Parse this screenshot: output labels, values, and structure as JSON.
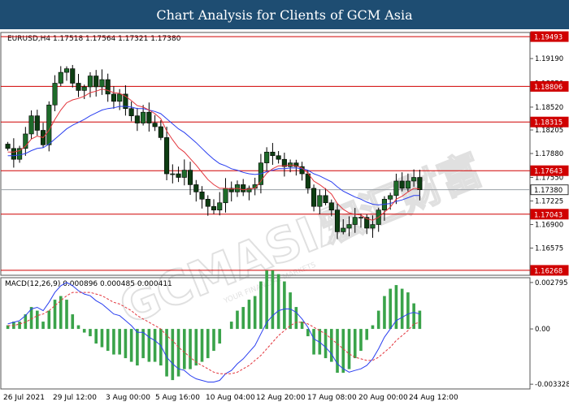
{
  "banner": {
    "title": "Chart Analysis for Clients of GCM Asia"
  },
  "watermark": {
    "brand": "GCMASIA",
    "tagline": "YOUR FINANCIAL MARKETS",
    "chinese": "宏汇财富"
  },
  "chart_data": [
    {
      "type": "candlestick",
      "header": "EURUSD,H4  1.17518 1.17564 1.17321 1.17380",
      "symbol": "EURUSD",
      "timeframe": "H4",
      "ohlc_last": {
        "open": 1.17518,
        "high": 1.17564,
        "low": 1.17321,
        "close": 1.1738
      },
      "ylim": [
        1.162,
        1.1955
      ],
      "y_ticks": [
        1.1919,
        1.1885,
        1.1852,
        1.18205,
        1.1788,
        1.1755,
        1.17225,
        1.169,
        1.16575
      ],
      "x_tick_labels": [
        "26 Jul 2021",
        "29 Jul 12:00",
        "3 Aug 00:00",
        "5 Aug 16:00",
        "10 Aug 04:00",
        "12 Aug 20:00",
        "17 Aug 08:00",
        "20 Aug 00:00",
        "24 Aug 12:00"
      ],
      "levels": [
        {
          "label": "1.19493",
          "value": 1.19493,
          "kind": "resistance"
        },
        {
          "label": "1.18806",
          "value": 1.18806,
          "kind": "resistance"
        },
        {
          "label": "1.18315",
          "value": 1.18315,
          "kind": "resistance"
        },
        {
          "label": "1.17643",
          "value": 1.17643,
          "kind": "resistance"
        },
        {
          "label": "1.17380",
          "value": 1.1738,
          "kind": "current"
        },
        {
          "label": "1.17043",
          "value": 1.17043,
          "kind": "support"
        },
        {
          "label": "1.16268",
          "value": 1.16268,
          "kind": "support"
        }
      ],
      "closes": [
        1.1795,
        1.178,
        1.1795,
        1.1815,
        1.184,
        1.182,
        1.18,
        1.1855,
        1.1885,
        1.19,
        1.1905,
        1.1885,
        1.1875,
        1.188,
        1.1895,
        1.188,
        1.189,
        1.187,
        1.186,
        1.187,
        1.185,
        1.184,
        1.183,
        1.1845,
        1.183,
        1.1825,
        1.181,
        1.176,
        1.176,
        1.1755,
        1.1765,
        1.1745,
        1.1735,
        1.1725,
        1.1715,
        1.171,
        1.172,
        1.174,
        1.1735,
        1.1745,
        1.1735,
        1.174,
        1.1745,
        1.1775,
        1.179,
        1.1785,
        1.178,
        1.177,
        1.1775,
        1.177,
        1.176,
        1.174,
        1.1715,
        1.173,
        1.172,
        1.171,
        1.168,
        1.1685,
        1.169,
        1.17,
        1.17,
        1.1685,
        1.169,
        1.171,
        1.1725,
        1.173,
        1.175,
        1.174,
        1.175,
        1.1755,
        1.1738
      ],
      "ma_fast_name": "",
      "ma_slow_name": "",
      "ma_fast": [
        1.179,
        1.179,
        1.1792,
        1.1798,
        1.1808,
        1.1812,
        1.181,
        1.182,
        1.1835,
        1.1848,
        1.1858,
        1.1862,
        1.1864,
        1.1867,
        1.1872,
        1.1874,
        1.1877,
        1.1875,
        1.1872,
        1.1871,
        1.1867,
        1.1861,
        1.1854,
        1.1852,
        1.1848,
        1.1843,
        1.1836,
        1.1819,
        1.1807,
        1.1796,
        1.179,
        1.1781,
        1.1772,
        1.1762,
        1.1752,
        1.1745,
        1.174,
        1.174,
        1.1739,
        1.174,
        1.1738,
        1.1739,
        1.174,
        1.175,
        1.1761,
        1.1767,
        1.1771,
        1.1771,
        1.1772,
        1.1771,
        1.1768,
        1.1761,
        1.175,
        1.1745,
        1.1739,
        1.1732,
        1.1719,
        1.1711,
        1.1706,
        1.1704,
        1.1703,
        1.1698,
        1.1696,
        1.17,
        1.1707,
        1.1714,
        1.1725,
        1.1729,
        1.1735,
        1.174,
        1.1739
      ],
      "ma_slow": [
        1.1785,
        1.1785,
        1.1786,
        1.1788,
        1.1792,
        1.1795,
        1.1796,
        1.1801,
        1.1808,
        1.1815,
        1.1822,
        1.1827,
        1.1831,
        1.1835,
        1.184,
        1.1844,
        1.1848,
        1.185,
        1.1851,
        1.1853,
        1.1853,
        1.1852,
        1.185,
        1.185,
        1.1848,
        1.1846,
        1.1843,
        1.1836,
        1.1829,
        1.1822,
        1.1817,
        1.181,
        1.1803,
        1.1795,
        1.1787,
        1.178,
        1.1774,
        1.1771,
        1.1767,
        1.1765,
        1.1762,
        1.176,
        1.1759,
        1.176,
        1.1763,
        1.1765,
        1.1767,
        1.1767,
        1.1768,
        1.1768,
        1.1767,
        1.1765,
        1.176,
        1.1757,
        1.1753,
        1.1749,
        1.1742,
        1.1736,
        1.1732,
        1.1728,
        1.1725,
        1.1721,
        1.1718,
        1.1717,
        1.1718,
        1.1719,
        1.1722,
        1.1724,
        1.1727,
        1.173,
        1.173
      ]
    },
    {
      "type": "macd",
      "header": "MACD(12,26,9) 0.000896 0.000485 0.000411",
      "params": "12,26,9",
      "ylim": [
        -0.00332,
        0.00279
      ],
      "y_ticks": [
        {
          "label": "0.002795",
          "value": 0.002795
        },
        {
          "label": "0.00",
          "value": 0.0
        },
        {
          "label": "-0.003328",
          "value": -0.003328
        }
      ],
      "main_line": [
        0.0003,
        0.0004,
        0.0005,
        0.0008,
        0.0012,
        0.0013,
        0.0011,
        0.0016,
        0.0022,
        0.0026,
        0.0028,
        0.0026,
        0.0023,
        0.0021,
        0.002,
        0.0017,
        0.0015,
        0.0012,
        0.0009,
        0.0008,
        0.0005,
        0.0002,
        -0.0002,
        -0.0002,
        -0.0005,
        -0.0007,
        -0.001,
        -0.0017,
        -0.0021,
        -0.0024,
        -0.0025,
        -0.0028,
        -0.003,
        -0.0031,
        -0.0032,
        -0.0032,
        -0.0031,
        -0.0027,
        -0.0025,
        -0.0021,
        -0.0018,
        -0.0014,
        -0.001,
        -0.0003,
        0.0004,
        0.0008,
        0.0011,
        0.0012,
        0.0012,
        0.001,
        0.0006,
        0.0001,
        -0.0006,
        -0.0008,
        -0.0011,
        -0.0015,
        -0.0021,
        -0.0024,
        -0.0026,
        -0.0025,
        -0.0024,
        -0.0022,
        -0.0018,
        -0.0012,
        -0.0005,
        0.0,
        0.0005,
        0.0007,
        0.0009,
        0.001,
        0.0009
      ],
      "signal_line": [
        0.0002,
        0.0002,
        0.0003,
        0.0004,
        0.0006,
        0.0008,
        0.0009,
        0.0011,
        0.0014,
        0.0017,
        0.002,
        0.0022,
        0.0022,
        0.0022,
        0.0022,
        0.0021,
        0.002,
        0.0018,
        0.0016,
        0.0015,
        0.0013,
        0.0011,
        0.0008,
        0.0006,
        0.0004,
        0.0002,
        0.0,
        -0.0004,
        -0.0007,
        -0.0011,
        -0.0014,
        -0.0017,
        -0.002,
        -0.0022,
        -0.0024,
        -0.0026,
        -0.0027,
        -0.0027,
        -0.0027,
        -0.0026,
        -0.0024,
        -0.0022,
        -0.0019,
        -0.0016,
        -0.0012,
        -0.0008,
        -0.0004,
        -0.0001,
        0.0002,
        0.0004,
        0.0004,
        0.0003,
        0.0001,
        -0.0001,
        -0.0003,
        -0.0006,
        -0.0009,
        -0.0012,
        -0.0015,
        -0.0017,
        -0.0018,
        -0.0019,
        -0.0019,
        -0.0017,
        -0.0014,
        -0.0011,
        -0.0007,
        -0.0004,
        -0.0001,
        0.0003,
        0.0004
      ]
    }
  ],
  "colors": {
    "banner_bg": "#1e4d72",
    "bull": "#1e6b2a",
    "bear": "#0d3d12",
    "ma_fast": "#e3353c",
    "ma_slow": "#2a3ff0",
    "level_line": "#d00000",
    "current_price": "#9aa0a6",
    "macd_main": "#2a3ff0",
    "macd_signal": "#e3353c",
    "macd_hist": "#3aa34a"
  }
}
